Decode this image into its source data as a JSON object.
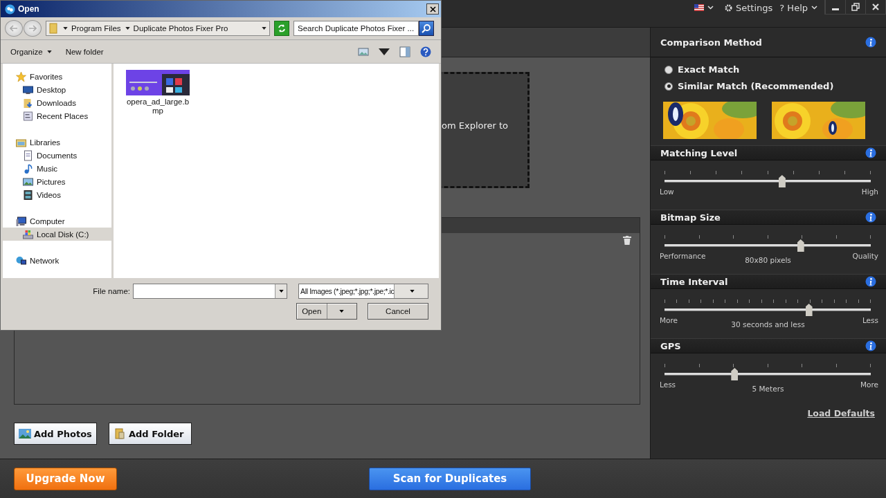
{
  "app": {
    "topbar": {
      "settings": "Settings",
      "help": "? Help"
    },
    "drop_zone": {
      "text": "om Explorer to"
    },
    "add_buttons": [
      {
        "label": "Add Photos",
        "kind": "photos"
      },
      {
        "label": "Add Folder",
        "kind": "folder"
      }
    ],
    "footer": {
      "upgrade": "Upgrade Now",
      "scan": "Scan for Duplicates"
    },
    "settings_panel": {
      "comparison": {
        "title": "Comparison Method",
        "options": [
          {
            "label": "Exact Match",
            "selected": false
          },
          {
            "label": "Similar Match (Recommended)",
            "selected": true
          }
        ]
      },
      "sliders": [
        {
          "title": "Matching Level",
          "level": 0.57,
          "min_label": "Low",
          "max_label": "High"
        },
        {
          "title": "Bitmap Size",
          "level": 0.66,
          "min_label": "Performance",
          "value_label": "80x80 pixels",
          "max_label": "Quality"
        },
        {
          "title": "Time Interval",
          "level": 0.7,
          "min_label": "More",
          "value_label": "30 seconds and less",
          "max_label": "Less"
        },
        {
          "title": "GPS",
          "level": 0.34,
          "min_label": "Less",
          "value_label": "5 Meters",
          "max_label": "More"
        }
      ],
      "load_defaults": "Load Defaults"
    }
  },
  "dialog": {
    "title": "Open",
    "address": [
      "Program Files",
      "Duplicate Photos Fixer Pro"
    ],
    "search": {
      "placeholder": "Search Duplicate Photos Fixer ..."
    },
    "toolbar": {
      "organize": "Organize",
      "new_folder": "New folder"
    },
    "nav": [
      {
        "label": "Favorites",
        "kind": "star",
        "selected": false,
        "children": [
          {
            "label": "Desktop",
            "kind": "desktop",
            "selected": false
          },
          {
            "label": "Downloads",
            "kind": "downloads",
            "selected": false
          },
          {
            "label": "Recent Places",
            "kind": "recent",
            "selected": false
          }
        ]
      },
      {
        "label": "Libraries",
        "kind": "libraries",
        "selected": false,
        "children": [
          {
            "label": "Documents",
            "kind": "documents",
            "selected": false
          },
          {
            "label": "Music",
            "kind": "music",
            "selected": false
          },
          {
            "label": "Pictures",
            "kind": "pictures",
            "selected": false
          },
          {
            "label": "Videos",
            "kind": "videos",
            "selected": false
          }
        ]
      },
      {
        "label": "Computer",
        "kind": "computer",
        "selected": false,
        "children": [
          {
            "label": "Local Disk (C:)",
            "kind": "disk",
            "selected": true
          }
        ]
      },
      {
        "label": "Network",
        "kind": "network",
        "selected": false
      }
    ],
    "files": [
      {
        "name": "opera_ad_large.bmp",
        "kind": "picture"
      }
    ],
    "file_name": {
      "label": "File name:"
    },
    "filter": "All Images (*.jpeg;*.jpg;*.jpe;*.ic",
    "buttons": {
      "open": "Open",
      "cancel": "Cancel"
    }
  }
}
